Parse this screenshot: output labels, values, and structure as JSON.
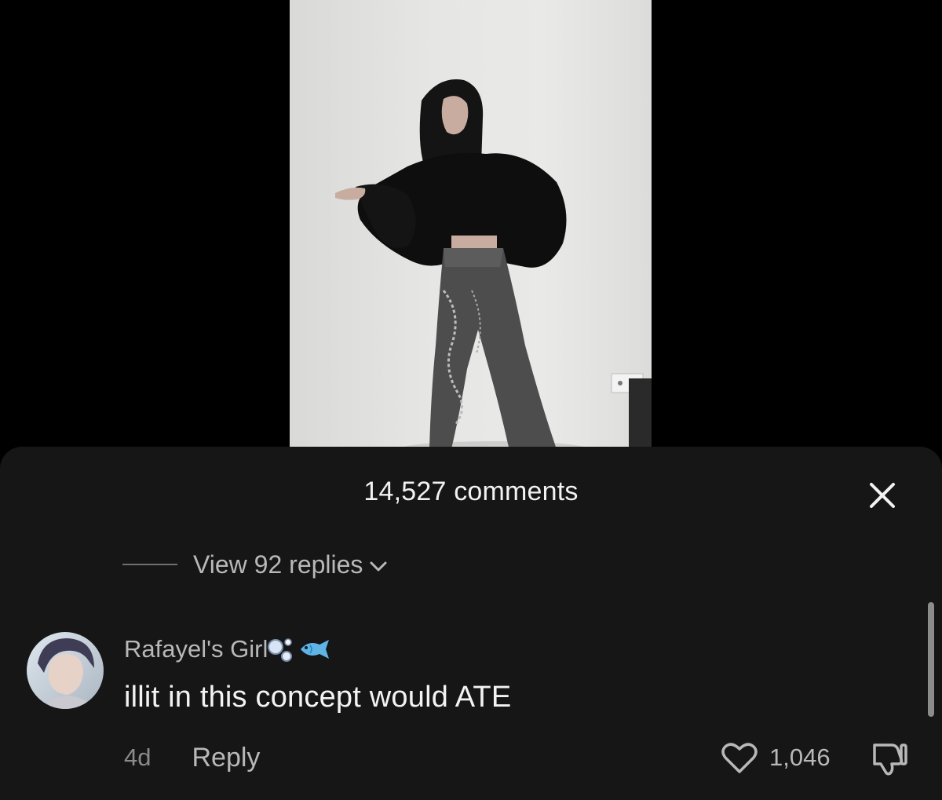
{
  "video": {
    "subject": "video-still"
  },
  "comments_sheet": {
    "title": "14,527 comments",
    "close_icon": "close-icon",
    "view_replies_label": "View 92 replies",
    "comment": {
      "username": "Rafayel's Girl",
      "username_emoji": [
        "bubbles-emoji",
        "fish-emoji"
      ],
      "text": "illit in this concept would ATE",
      "time": "4d",
      "reply_label": "Reply",
      "like_count": "1,046"
    }
  },
  "colors": {
    "sheet_bg": "#161616",
    "text_primary": "#f3f3f3",
    "text_secondary": "#b8b8b8",
    "text_muted": "#8a8a8a"
  }
}
